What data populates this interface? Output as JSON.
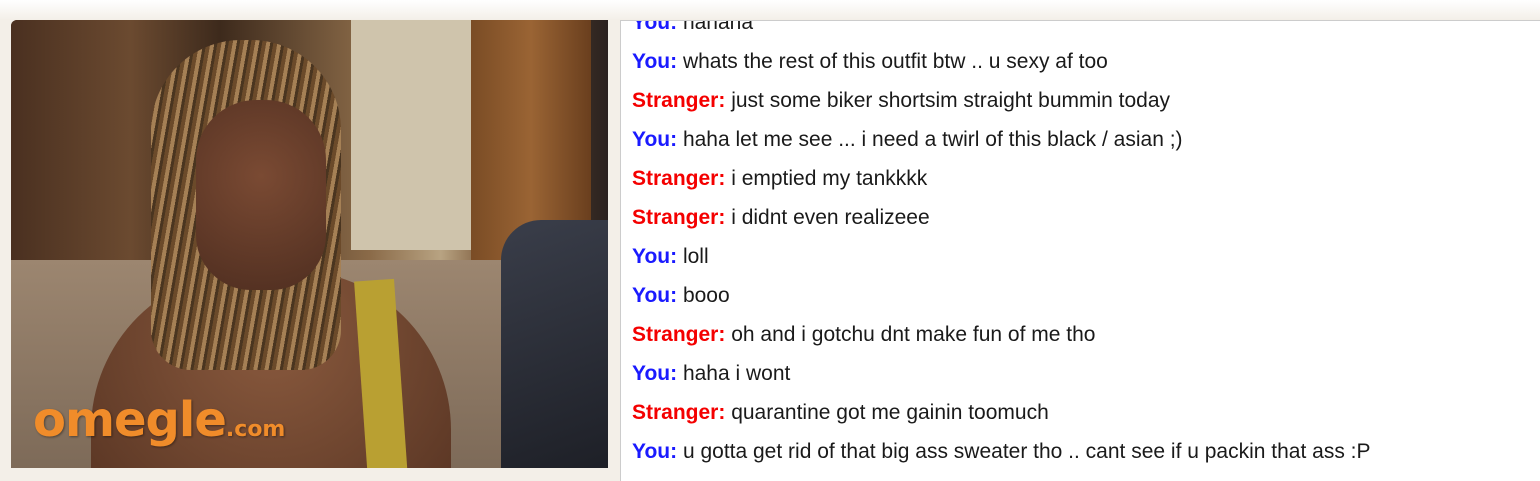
{
  "video": {
    "logo_main": "omegle",
    "logo_suffix": ".com"
  },
  "colors": {
    "you": "#1a1aff",
    "stranger": "#f40000",
    "logo": "#f08c2a"
  },
  "chat": {
    "messages": [
      {
        "speaker": "You:",
        "role": "you",
        "text": "hahaha"
      },
      {
        "speaker": "You:",
        "role": "you",
        "text": "whats the rest of this outfit btw .. u sexy af too"
      },
      {
        "speaker": "Stranger:",
        "role": "stranger",
        "text": "just some biker shortsim straight bummin today"
      },
      {
        "speaker": "You:",
        "role": "you",
        "text": "haha let me see ... i need a twirl of this black / asian ;)"
      },
      {
        "speaker": "Stranger:",
        "role": "stranger",
        "text": "i emptied my tankkkk"
      },
      {
        "speaker": "Stranger:",
        "role": "stranger",
        "text": "i didnt even realizeee"
      },
      {
        "speaker": "You:",
        "role": "you",
        "text": "loll"
      },
      {
        "speaker": "You:",
        "role": "you",
        "text": "booo"
      },
      {
        "speaker": "Stranger:",
        "role": "stranger",
        "text": "oh and i gotchu dnt make fun of me tho"
      },
      {
        "speaker": "You:",
        "role": "you",
        "text": "haha i wont"
      },
      {
        "speaker": "Stranger:",
        "role": "stranger",
        "text": "quarantine got me gainin toomuch"
      },
      {
        "speaker": "You:",
        "role": "you",
        "text": "u gotta get rid of that big ass sweater tho .. cant see if u packin that ass :P"
      }
    ]
  }
}
